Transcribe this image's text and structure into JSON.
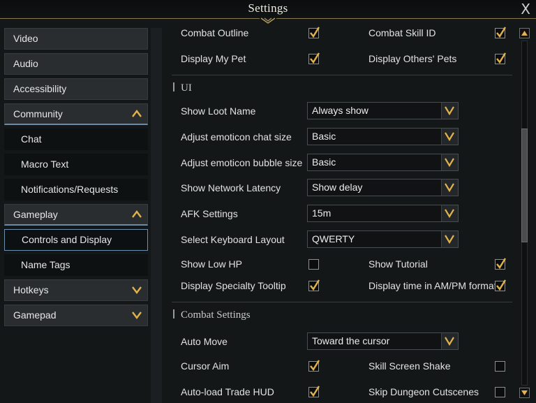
{
  "window": {
    "title": "Settings",
    "close_label": "X"
  },
  "sidebar": {
    "items": [
      {
        "label": "Video"
      },
      {
        "label": "Audio"
      },
      {
        "label": "Accessibility"
      },
      {
        "label": "Community",
        "expanded": true
      },
      {
        "label": "Chat"
      },
      {
        "label": "Macro Text"
      },
      {
        "label": "Notifications/Requests"
      },
      {
        "label": "Gameplay",
        "expanded": true
      },
      {
        "label": "Controls and Display",
        "selected": true
      },
      {
        "label": "Name Tags"
      },
      {
        "label": "Hotkeys"
      },
      {
        "label": "Gamepad"
      }
    ]
  },
  "display": {
    "combat_outline": {
      "label": "Combat Outline",
      "checked": true
    },
    "combat_skill_id": {
      "label": "Combat Skill ID",
      "checked": true
    },
    "display_my_pet": {
      "label": "Display My Pet",
      "checked": true
    },
    "display_others_pets": {
      "label": "Display Others' Pets",
      "checked": true
    }
  },
  "ui": {
    "title": "UI",
    "show_loot_name": {
      "label": "Show Loot Name",
      "value": "Always show"
    },
    "emoticon_chat_size": {
      "label": "Adjust emoticon chat size",
      "value": "Basic"
    },
    "emoticon_bubble_size": {
      "label": "Adjust emoticon bubble size",
      "value": "Basic"
    },
    "network_latency": {
      "label": "Show Network Latency",
      "value": "Show delay"
    },
    "afk": {
      "label": "AFK Settings",
      "value": "15m"
    },
    "keyboard_layout": {
      "label": "Select Keyboard Layout",
      "value": "QWERTY"
    },
    "show_low_hp": {
      "label": "Show Low HP",
      "checked": false
    },
    "show_tutorial": {
      "label": "Show Tutorial",
      "checked": true
    },
    "specialty_tooltip": {
      "label": "Display Specialty Tooltip",
      "checked": true
    },
    "ampm_format": {
      "label": "Display time in AM/PM format",
      "checked": true
    }
  },
  "combat": {
    "title": "Combat Settings",
    "auto_move": {
      "label": "Auto Move",
      "value": "Toward the cursor"
    },
    "cursor_aim": {
      "label": "Cursor Aim",
      "checked": true
    },
    "skill_screen_shake": {
      "label": "Skill Screen Shake",
      "checked": false
    },
    "auto_load_trade_hud": {
      "label": "Auto-load Trade HUD",
      "checked": true
    },
    "skip_dungeon_cutscenes": {
      "label": "Skip Dungeon Cutscenes",
      "checked": false
    }
  },
  "colors": {
    "accent_gold": "#e2b34a",
    "selected_border": "#6e8fae"
  }
}
